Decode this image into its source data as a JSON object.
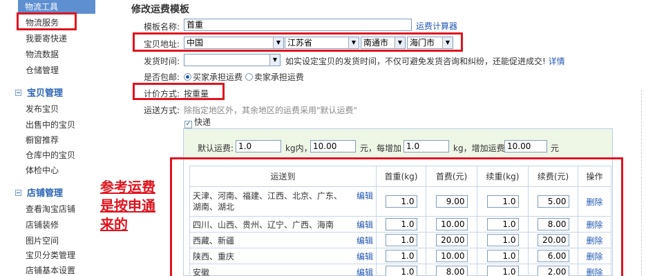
{
  "sidebar": {
    "top_item": "物流工具",
    "group1": [
      "物流服务",
      "我要寄快递",
      "物流数据",
      "仓储管理"
    ],
    "section2_title": "宝贝管理",
    "group2": [
      "发布宝贝",
      "出售中的宝贝",
      "橱窗推荐",
      "仓库中的宝贝",
      "体检中心"
    ],
    "section3_title": "店铺管理",
    "group3": [
      "查看淘宝店铺",
      "店铺装修",
      "图片空间",
      "宝贝分类管理",
      "店铺基本设置"
    ]
  },
  "form": {
    "title": "修改运费模板",
    "name_label": "模板名称:",
    "name_value": "首重",
    "calc_link": "运费计算器",
    "address_label": "宝贝地址:",
    "country": "中国",
    "province": "江苏省",
    "city": "南通市",
    "district": "海门市",
    "ship_time_label": "发货时间:",
    "ship_time_hint": "如实设定宝贝的发货时间，不仅可避免发货咨询和纠纷，还能促进成交!",
    "ship_time_link": "详情",
    "free_ship_label": "是否包邮:",
    "free_opt1": "买家承担运费",
    "free_opt2": "卖家承担运费",
    "pricing_label": "计价方式:",
    "pricing_value": "按重量",
    "shipping_label": "运送方式:",
    "shipping_hint": "除指定地区外，其余地区的运费采用\"默认运费\"",
    "express_label": "快递"
  },
  "default_fee": {
    "label": "默认运费:",
    "first_weight": "1.0",
    "unit_kg_in": "kg内，",
    "first_fee": "10.00",
    "text_each": "元，每增加",
    "add_weight": "1.0",
    "text_add": "kg，增加运费",
    "add_fee": "10.00",
    "unit_yuan": "元"
  },
  "table": {
    "headers": [
      "运送到",
      "首重(kg)",
      "首费(元)",
      "续重(kg)",
      "续费(元)",
      "操作"
    ],
    "edit_label": "编辑",
    "delete_label": "删除",
    "rows": [
      {
        "region": "天津、河南、福建、江西、北京、广东、湖南、湖北",
        "w1": "1.0",
        "f1": "9.00",
        "w2": "1.0",
        "f2": "5.00"
      },
      {
        "region": "四川、山西、贵州、辽宁、广西、海南",
        "w1": "1.0",
        "f1": "10.00",
        "w2": "1.0",
        "f2": "8.00"
      },
      {
        "region": "西藏、新疆",
        "w1": "1.0",
        "f1": "20.00",
        "w2": "1.0",
        "f2": "20.00"
      },
      {
        "region": "陕西、重庆",
        "w1": "1.0",
        "f1": "10.00",
        "w2": "1.0",
        "f2": "6.00"
      },
      {
        "region": "安徽",
        "w1": "1.0",
        "f1": "8.00",
        "w2": "1.0",
        "f2": "2.00"
      }
    ]
  },
  "annotation": [
    "参考运费",
    "是按申通",
    "来的"
  ]
}
